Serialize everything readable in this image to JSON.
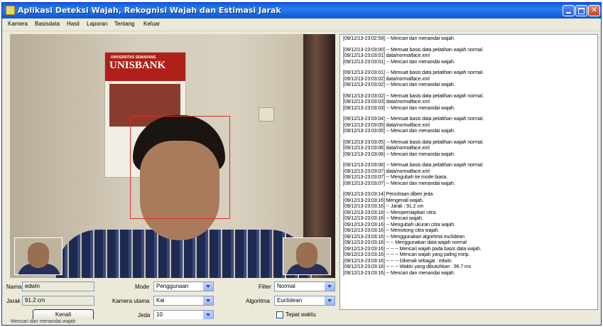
{
  "window": {
    "title": "Aplikasi Deteksi Wajah, Rekognisi Wajah dan Estimasi Jarak",
    "controls": [
      "minimize-icon",
      "maximize-icon",
      "close-icon"
    ]
  },
  "menu": [
    "Kamera",
    "Basisdata",
    "Hasil",
    "Laporan",
    "Tentang",
    "Keluar"
  ],
  "poster": {
    "line1": "UNIVERSITAS SEMARANG",
    "line2": "UNISBANK"
  },
  "log": [
    "[09/12/13-23:02:59] -- Mencari dan menandai wajah.",
    "",
    "[09/12/13-23:03:00] -- Memuat basis data pelatihan wajah normal.",
    "[09/12/13-23:03:01] data/normalface.xml",
    "[09/12/13-23:03:01] -- Mencari dan menandai wajah.",
    "",
    "[09/12/13-23:03:01] -- Memuat basis data pelatihan wajah normal.",
    "[09/12/13-23:03:02] data/normalface.xml",
    "[09/12/13-23:03:02] -- Mencari dan menandai wajah.",
    "",
    "[09/12/13-23:03:02] -- Memuat basis data pelatihan wajah normal.",
    "[09/12/13-23:03:03] data/normalface.xml",
    "[09/12/13-23:03:03] -- Mencari dan menandai wajah.",
    "",
    "[09/12/13-23:03:04] -- Memuat basis data pelatihan wajah normal.",
    "[09/12/13-23:03:05] data/normalface.xml",
    "[09/12/13-23:03:05] -- Mencari dan menandai wajah.",
    "",
    "[09/12/13-23:03:05] -- Memuat basis data pelatihan wajah normal.",
    "[09/12/13-23:03:06] data/normalface.xml",
    "[09/12/13-23:03:06] -- Mencari dan menandai wajah.",
    "",
    "[09/12/13-23:03:06] -- Memuat basis data pelatihan wajah normal.",
    "[09/12/13-23:03:07] data/normalface.xml",
    "[09/12/13-23:03:07] -- Mengubah ke mode biasa.",
    "[09/12/13-23:03:07] -- Mencari dan menandai wajah.",
    "",
    "[09/12/13-23:03:14] Pencitraan diberi jeda.",
    "[09/12/13-23:03:16] Mengenali wajah.",
    "[09/12/13-23:03:16] -- Jarak : 91.2 cm",
    "[09/12/13-23:03:16] -- Mempersiapkan citra.",
    "[09/12/13-23:03:16] -- Mencari wajah.",
    "[09/12/13-23:03:16] -- Mengubah ukuran citra wajah.",
    "[09/12/13-23:03:16] -- Memotong citra wajah.",
    "[09/12/13-23:03:16] -- Menggunakan algoritma euclidean",
    "[09/12/13-23:03:16] -- -- Menggunakan data wajah normal",
    "[09/12/13-23:03:16] -- -- -- Mencari wajah pada basis data wajah.",
    "[09/12/13-23:03:16] -- -- -- Mencari wajah yang paling mirip.",
    "[09/12/13-23:03:16] -- -- -- Dikenali sebagai : edwin",
    "[09/12/13-23:03:16] -- -- -- Waktu yang dibutuhkan : 96.7 ms",
    "[09/12/13-23:03:16] -- Mencari dan menandai wajah."
  ],
  "form": {
    "nama_label": "Nama",
    "nama_value": "edwin",
    "jarak_label": "Jarak",
    "jarak_value": "91.2 cm",
    "kenali_button": "Kenali",
    "mode_label": "Mode",
    "mode_value": "Penggunaan",
    "kamera_label": "Kamera utama",
    "kamera_value": "Kai",
    "jeda_label": "Jeda",
    "jeda_value": "10",
    "filter_label": "Filter",
    "filter_value": "Normal",
    "algoritma_label": "Algoritma",
    "algoritma_value": "Euclidean",
    "tepat_waktu_label": "Tepat waktu"
  },
  "status": "Mencari dan menandai wajah"
}
